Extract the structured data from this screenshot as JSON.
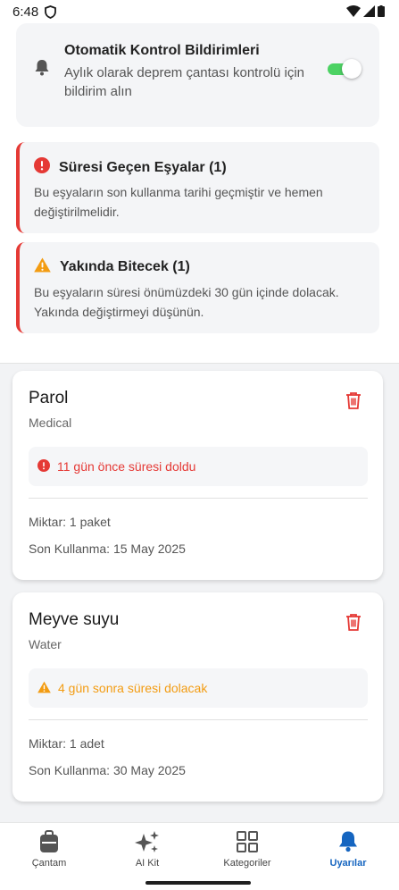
{
  "status_bar": {
    "time": "6:48"
  },
  "notification_setting": {
    "title": "Otomatik Kontrol Bildirimleri",
    "description": "Aylık olarak deprem çantası kontrolü için bildirim alın",
    "enabled": true,
    "toggle_color": "#4cd263"
  },
  "alerts": {
    "expired": {
      "title": "Süresi Geçen Eşyalar (1)",
      "description": "Bu eşyaların son kullanma tarihi geçmiştir ve hemen değiştirilmelidir.",
      "icon": "error-circle-icon",
      "color": "#e53935"
    },
    "soon": {
      "title": "Yakında Bitecek (1)",
      "description": "Bu eşyaların süresi önümüzdeki 30 gün içinde dolacak. Yakında değiştirmeyi düşünün.",
      "icon": "warning-triangle-icon",
      "color": "#f39c12"
    }
  },
  "items": [
    {
      "name": "Parol",
      "category": "Medical",
      "status": "11 gün önce süresi doldu",
      "status_type": "expired",
      "quantity": "Miktar: 1 paket",
      "expiry": "Son Kullanma: 15 May 2025"
    },
    {
      "name": "Meyve suyu",
      "category": "Water",
      "status": "4 gün sonra süresi dolacak",
      "status_type": "soon",
      "quantity": "Miktar: 1 adet",
      "expiry": "Son Kullanma: 30 May 2025"
    }
  ],
  "bottom_nav": [
    {
      "label": "Çantam",
      "icon": "bag-icon"
    },
    {
      "label": "AI Kit",
      "icon": "sparkle-icon"
    },
    {
      "label": "Kategoriler",
      "icon": "grid-icon"
    },
    {
      "label": "Uyarılar",
      "icon": "bell-icon",
      "active": true
    }
  ],
  "colors": {
    "accent": "#1565c0",
    "danger": "#e53935",
    "warning": "#f39c12"
  }
}
